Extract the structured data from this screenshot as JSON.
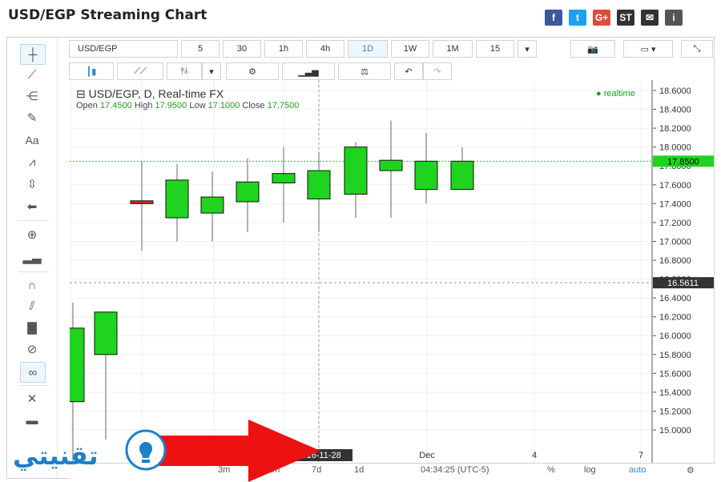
{
  "page": {
    "title": "USD/EGP Streaming Chart"
  },
  "share": [
    {
      "name": "facebook",
      "label": "f",
      "color": "#3b5998"
    },
    {
      "name": "twitter",
      "label": "t",
      "color": "#1da1f2"
    },
    {
      "name": "googleplus",
      "label": "G+",
      "color": "#dd4b39"
    },
    {
      "name": "stocktwits",
      "label": "ST",
      "color": "#333333"
    },
    {
      "name": "email",
      "label": "✉",
      "color": "#333333"
    },
    {
      "name": "info",
      "label": "i",
      "color": "#555555"
    }
  ],
  "toolbar": {
    "symbol": "USD/EGP",
    "intervals": [
      "5",
      "30",
      "1h",
      "4h",
      "1D",
      "1W",
      "1M",
      "15"
    ],
    "active_interval": "1D"
  },
  "legend": {
    "title": "USD/EGP, D, Real-time FX",
    "open_label": "Open",
    "open": "17.4500",
    "high_label": "High",
    "high": "17.9500",
    "low_label": "Low",
    "low": "17.1000",
    "close_label": "Close",
    "close": "17.7500",
    "realtime": "realtime"
  },
  "bottom": {
    "ranges": [
      "3m",
      "1m",
      "7d",
      "1d"
    ],
    "time": "04:34:25 (UTC-5)",
    "percent": "%",
    "log": "log",
    "auto": "auto"
  },
  "watermark": {
    "text": "تقنيتي"
  },
  "chart_data": {
    "type": "candlestick",
    "title": "USD/EGP, D, Real-time FX",
    "ylim": [
      14.8,
      18.7
    ],
    "y_ticks": [
      "18.6000",
      "18.4000",
      "18.2000",
      "18.0000",
      "17.8000",
      "17.6000",
      "17.4000",
      "17.2000",
      "17.0000",
      "16.8000",
      "16.6000",
      "16.4000",
      "16.2000",
      "16.0000",
      "15.8000",
      "15.6000",
      "15.4000",
      "15.2000",
      "15.0000"
    ],
    "x_labels": [
      {
        "label": "2016-11-28",
        "highlight": true
      },
      {
        "label": "Dec",
        "highlight": false
      },
      {
        "label": "4",
        "highlight": false
      },
      {
        "label": "7",
        "highlight": false
      }
    ],
    "last_price": "17.8500",
    "crosshair_price": "16.5611",
    "candles": [
      {
        "open": 15.3,
        "close": 16.08,
        "high": 16.35,
        "low": 14.5,
        "dir": "up"
      },
      {
        "open": 15.8,
        "close": 16.25,
        "high": 16.25,
        "low": 14.9,
        "dir": "up"
      },
      {
        "open": 17.43,
        "close": 17.4,
        "high": 17.85,
        "low": 16.9,
        "dir": "down"
      },
      {
        "open": 17.25,
        "close": 17.65,
        "high": 17.82,
        "low": 17.0,
        "dir": "up"
      },
      {
        "open": 17.3,
        "close": 17.47,
        "high": 17.74,
        "low": 17.0,
        "dir": "up"
      },
      {
        "open": 17.42,
        "close": 17.63,
        "high": 17.88,
        "low": 17.1,
        "dir": "up"
      },
      {
        "open": 17.62,
        "close": 17.72,
        "high": 18.0,
        "low": 17.2,
        "dir": "up"
      },
      {
        "open": 17.45,
        "close": 17.75,
        "high": 17.95,
        "low": 17.1,
        "dir": "up"
      },
      {
        "open": 17.5,
        "close": 18.0,
        "high": 18.05,
        "low": 17.25,
        "dir": "up"
      },
      {
        "open": 17.75,
        "close": 17.86,
        "high": 18.28,
        "low": 17.25,
        "dir": "up"
      },
      {
        "open": 17.55,
        "close": 17.85,
        "high": 18.15,
        "low": 17.4,
        "dir": "up"
      },
      {
        "open": 17.55,
        "close": 17.85,
        "high": 18.0,
        "low": 17.55,
        "dir": "up"
      }
    ],
    "colors": {
      "up": "#1ed41e",
      "down": "#e8201e",
      "wick": "#999999"
    }
  }
}
